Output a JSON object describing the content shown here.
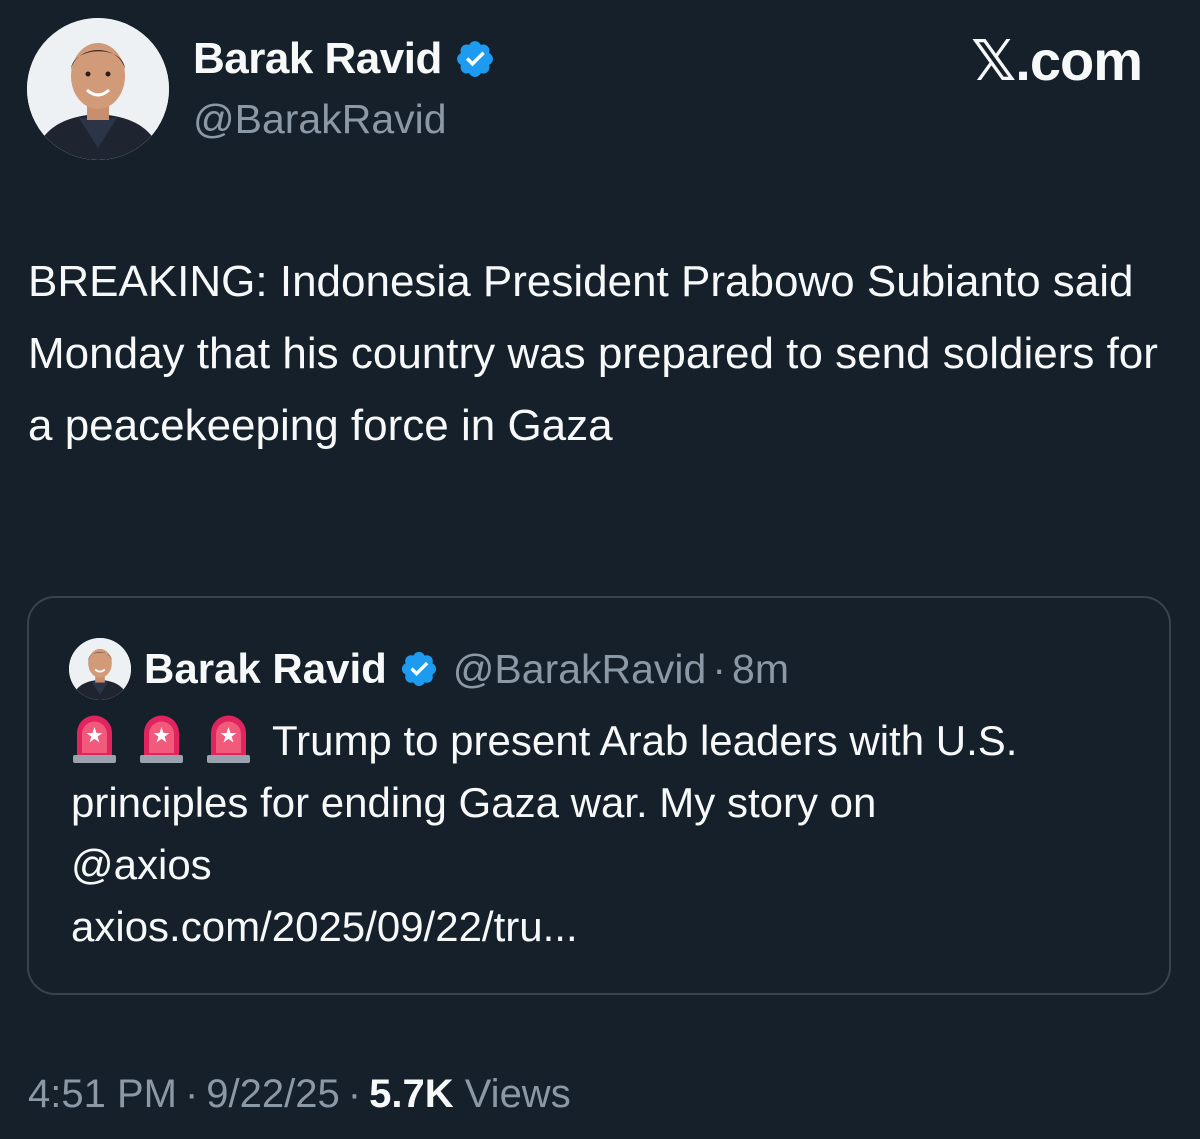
{
  "author": {
    "name": "Barak Ravid",
    "handle": "@BarakRavid"
  },
  "brand": "𝕏.com",
  "tweet": {
    "text": "BREAKING: Indonesia President Prabowo Subianto said Monday that his country was prepared to send soldiers for a peacekeeping force in Gaza"
  },
  "quoted_tweet": {
    "name": "Barak Ravid",
    "handle": "@BarakRavid",
    "separator": "·",
    "time": "8m",
    "text_line1": "Trump to present Arab leaders with U.S.",
    "text_line2": "principles for ending Gaza war. My story on",
    "mention": "@axios",
    "link": "axios.com/2025/09/22/tru..."
  },
  "meta": {
    "time": "4:51 PM",
    "separator": "·",
    "date": "9/22/25",
    "views_count": "5.7K",
    "views_label": "Views"
  },
  "icons": {
    "verified": "verified-badge-icon",
    "siren": "police-siren-icon"
  },
  "colors": {
    "background": "#15202b",
    "text": "#f7f9f9",
    "secondary": "#8b98a5",
    "verified": "#1d9bf0",
    "border": "#38444d"
  }
}
